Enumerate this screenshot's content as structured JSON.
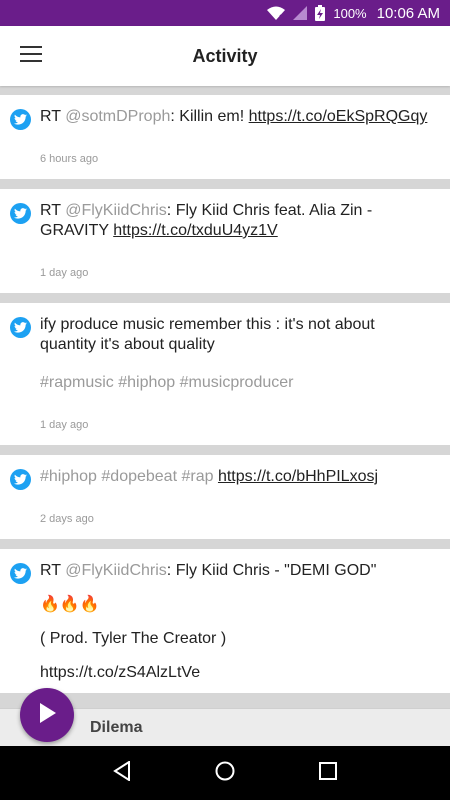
{
  "status_bar": {
    "battery": "100%",
    "time": "10:06 AM",
    "icons": [
      "wifi-icon",
      "signal-icon",
      "battery-charging-icon"
    ]
  },
  "app_bar": {
    "title": "Activity",
    "menu_icon": "hamburger-menu-icon"
  },
  "feed": {
    "tweets": [
      {
        "prefix": "RT ",
        "mention": "@sotmDProph",
        "text": ": Killin em! ",
        "link": "https://t.co/oEkSpRQGqy",
        "time": "6 hours ago"
      },
      {
        "prefix": "RT ",
        "mention": "@FlyKiidChris",
        "text": ": Fly Kiid Chris feat. Alia Zin - GRAVITY ",
        "link": "https://t.co/txduU4yz1V",
        "time": "1 day ago"
      },
      {
        "text": "ify produce music remember this : it's not about quantity it's about quality",
        "hashtags": "#rapmusic #hiphop #musicproducer",
        "time": "1 day ago"
      },
      {
        "hashtags": "#hiphop #dopebeat #rap",
        "link": "https://t.co/bHhPILxosj",
        "time": "2 days ago"
      },
      {
        "prefix": "RT ",
        "mention": "@FlyKiidChris",
        "text": ": Fly Kiid Chris - \"DEMI GOD\"",
        "emoji": "🔥🔥🔥",
        "line2": "( Prod. Tyler The Creator )",
        "link": "https://t.co/zS4AlzLtVe"
      }
    ]
  },
  "player": {
    "track": "Dilema",
    "play_icon": "play-icon"
  },
  "nav_bar": {
    "icons": [
      "back-icon",
      "home-icon",
      "recents-icon"
    ]
  },
  "colors": {
    "primary": "#6a1d8a",
    "twitter": "#1da1f2",
    "muted": "#9a9a9a"
  }
}
